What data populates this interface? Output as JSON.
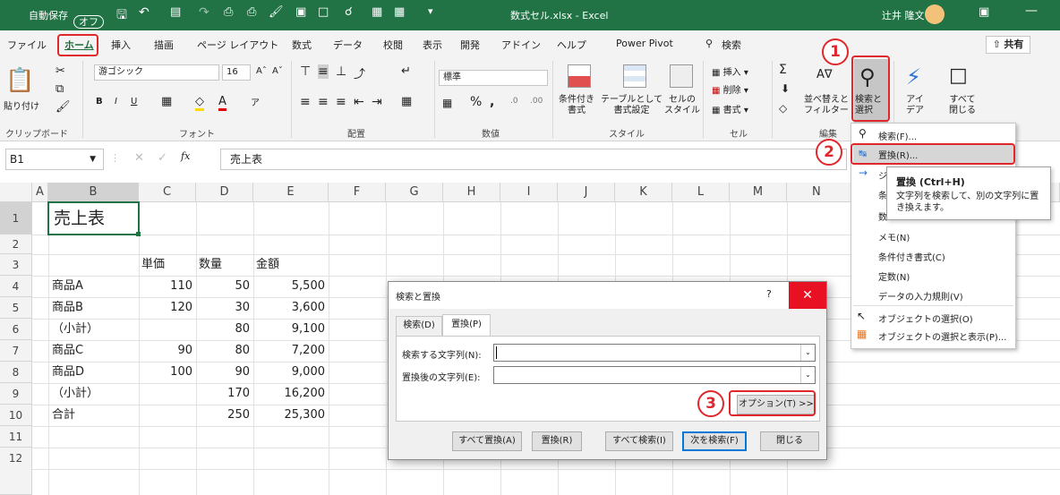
{
  "titlebar": {
    "autosave_label": "自動保存",
    "autosave_state": "オフ",
    "filename": "数式セル.xlsx  -  Excel",
    "user": "辻井 隆文"
  },
  "tabs": [
    "ファイル",
    "ホーム",
    "挿入",
    "描画",
    "ページ レイアウト",
    "数式",
    "データ",
    "校閲",
    "表示",
    "開発",
    "アドイン",
    "ヘルプ",
    "Power Pivot"
  ],
  "search_tab": "検索",
  "share_label": "共有",
  "ribbon": {
    "paste": "貼り付け",
    "font_name": "游ゴシック",
    "font_size": "16",
    "number_format": "標準",
    "cond_format": "条件付き\n書式",
    "table_format": "テーブルとして\n書式設定",
    "cell_style": "セルの\nスタイル",
    "insert": "挿入",
    "delete": "削除",
    "format": "書式",
    "sort_filter": "並べ替えと\nフィルター",
    "find_select": "検索と\n選択",
    "ideas": "アイ\nデア",
    "close_all": "すべて\n閉じる",
    "groups": {
      "clipboard": "クリップボード",
      "font": "フォント",
      "alignment": "配置",
      "number": "数値",
      "styles": "スタイル",
      "cells": "セル",
      "editing": "編集"
    }
  },
  "formula_bar": {
    "name_box": "B1",
    "fx": "fx",
    "content": "売上表"
  },
  "columns": [
    "A",
    "B",
    "C",
    "D",
    "E",
    "F",
    "G",
    "H",
    "I",
    "J",
    "K",
    "L",
    "M",
    "N"
  ],
  "rows": [
    "1",
    "2",
    "3",
    "4",
    "5",
    "6",
    "7",
    "8",
    "9",
    "10",
    "11",
    "12"
  ],
  "sheet": {
    "title": "売上表",
    "headers": [
      "単価",
      "数量",
      "金額"
    ],
    "data": [
      [
        "商品A",
        "110",
        "50",
        "5,500"
      ],
      [
        "商品B",
        "120",
        "30",
        "3,600"
      ],
      [
        "（小計）",
        "",
        "80",
        "9,100"
      ],
      [
        "商品C",
        "90",
        "80",
        "7,200"
      ],
      [
        "商品D",
        "100",
        "90",
        "9,000"
      ],
      [
        "（小計）",
        "",
        "170",
        "16,200"
      ],
      [
        "合計",
        "",
        "250",
        "25,300"
      ]
    ]
  },
  "menu": {
    "items": [
      "検索(F)...",
      "置換(R)...",
      "ジ",
      "条",
      "数",
      "メモ(N)",
      "条件付き書式(C)",
      "定数(N)",
      "データの入力規則(V)",
      "オブジェクトの選択(O)",
      "オブジェクトの選択と表示(P)..."
    ]
  },
  "tooltip": {
    "title": "置換 (Ctrl+H)",
    "body": "文字列を検索して、別の文字列に置き換えます。"
  },
  "dialog": {
    "title": "検索と置換",
    "help": "?",
    "tabs": [
      "検索(D)",
      "置換(P)"
    ],
    "find_label": "検索する文字列(N):",
    "replace_label": "置換後の文字列(E):",
    "options_button": "オプション(T) >>",
    "buttons": [
      "すべて置換(A)",
      "置換(R)",
      "すべて検索(I)",
      "次を検索(F)",
      "閉じる"
    ]
  },
  "step_markers": [
    "1",
    "2",
    "3"
  ],
  "colors": {
    "excel_green": "#217346",
    "highlight_red": "#e0282c",
    "close_red": "#e81123"
  }
}
